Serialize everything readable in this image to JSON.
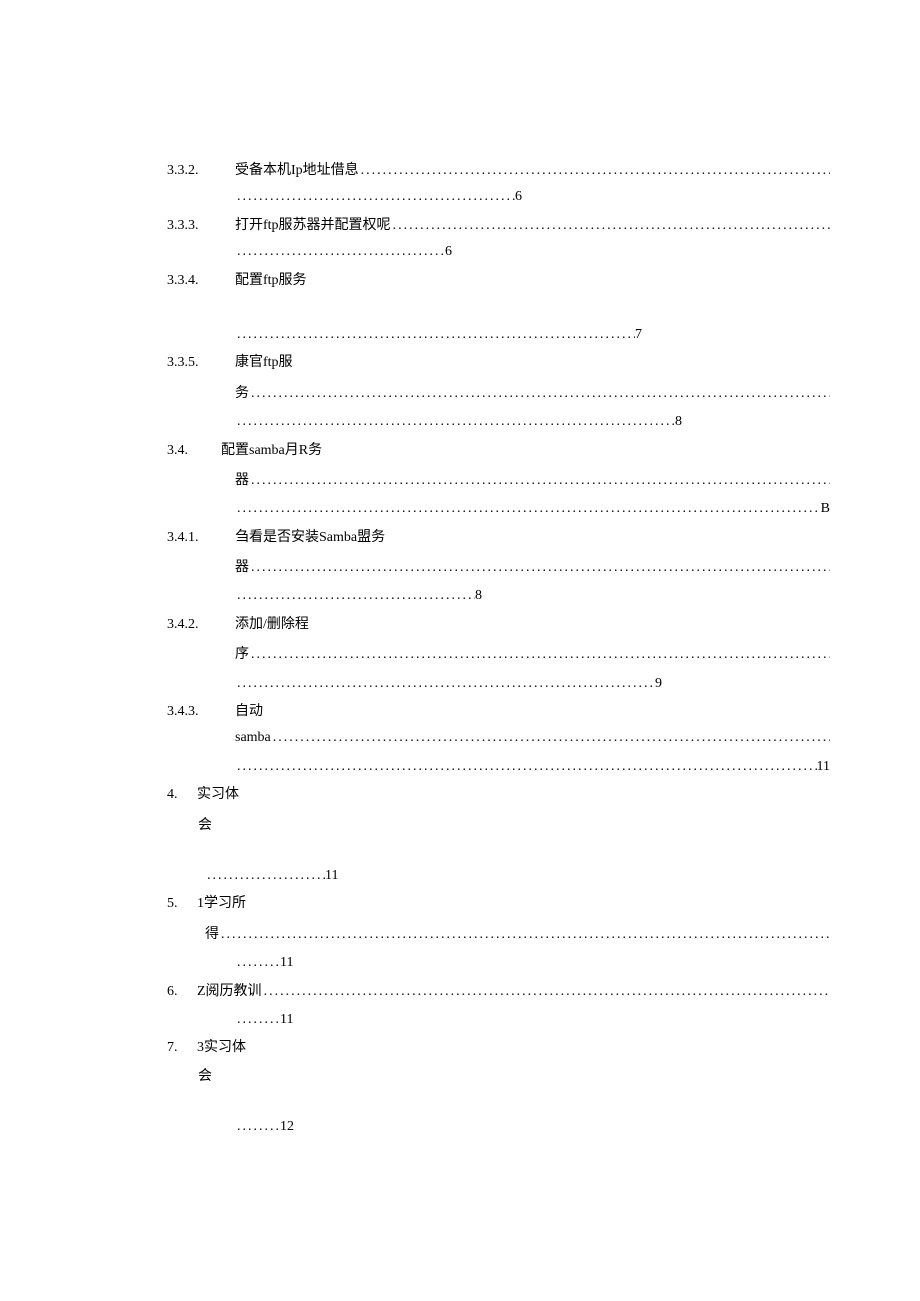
{
  "entries": {
    "e332": {
      "num": "3.3.2.",
      "title": "受备本机Ip地址借息",
      "page": "6"
    },
    "e333": {
      "num": "3.3.3.",
      "title": "打开ftp服苏器并配置权呢",
      "page": "6"
    },
    "e334": {
      "num": "3.3.4.",
      "title": "配置ftp服务",
      "page": "7"
    },
    "e335": {
      "num": "3.3.5.",
      "title": "康官ftp服",
      "title2": "务",
      "page": "8"
    },
    "e34": {
      "num": "3.4.",
      "title": "配置samba月R务",
      "title2": "器",
      "page": "B"
    },
    "e341": {
      "num": "3.4.1.",
      "title": "刍看是否安装Samba盟务",
      "title2": "器",
      "page": "8"
    },
    "e342": {
      "num": "3.4.2.",
      "title": "添加/删除程",
      "title2": "序",
      "page": "9"
    },
    "e343": {
      "num": "3.4.3.",
      "title": "自动",
      "title2": "samba",
      "page": "11"
    },
    "e4": {
      "num": "4.",
      "title": "实习体",
      "title2": "会",
      "page": "11"
    },
    "e5": {
      "num": "5.",
      "title": "1学习所",
      "title2": "得",
      "page": "11"
    },
    "e6": {
      "num": "6.",
      "title": "Z阅历教训",
      "page": "11"
    },
    "e7": {
      "num": "7.",
      "title": "3实习体",
      "title2": "会",
      "page": "12"
    }
  }
}
